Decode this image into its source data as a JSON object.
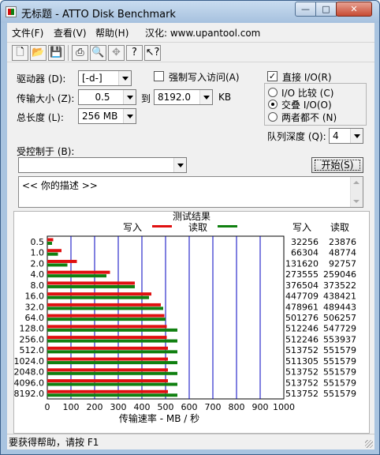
{
  "window": {
    "title": "无标题 - ATTO Disk Benchmark",
    "minimize": "—",
    "maximize": "□",
    "close": "✕"
  },
  "menu": [
    "文件(F)",
    "查看(V)",
    "帮助(H)",
    "汉化: www.upantool.com"
  ],
  "toolbar_icons": [
    "new-icon",
    "open-icon",
    "save-icon",
    "print-icon",
    "print-preview-icon",
    "move-icon",
    "help-icon",
    "context-help-icon"
  ],
  "form": {
    "drive_label": "驱动器 (D):",
    "drive_value": "[-d-]",
    "force_write_label": "强制写入访问(A)",
    "force_write_checked": false,
    "transfer_label": "传输大小 (Z):",
    "transfer_from": "0.5",
    "transfer_to_label": "到",
    "transfer_to": "8192.0",
    "transfer_unit": "KB",
    "total_length_label": "总长度 (L):",
    "total_length_value": "256 MB",
    "direct_io_label": "直接 I/O(R)",
    "direct_io_checked": true,
    "radio_compare": "I/O 比较 (C)",
    "radio_overlap": "交叠 I/O(O)",
    "radio_neither": "两者都不 (N)",
    "radio_selected": "overlap",
    "queue_depth_label": "队列深度 (Q):",
    "queue_depth_value": "4",
    "controlled_by_label": "受控制于 (B):",
    "controlled_by_value": "",
    "start_button": "开始(S)",
    "description": "<<  你的描述   >>"
  },
  "results": {
    "title": "测试结果",
    "legend_write": "写入",
    "legend_read": "读取",
    "col_write": "写入",
    "col_read": "读取",
    "xlabel": "传输速率 - MB / 秒"
  },
  "chart_data": {
    "type": "bar",
    "title": "测试结果",
    "xlabel": "传输速率 - MB / 秒",
    "xlim": [
      0,
      1000
    ],
    "xticks": [
      0,
      100,
      200,
      300,
      400,
      500,
      600,
      700,
      800,
      900,
      1000
    ],
    "categories": [
      "0.5",
      "1.0",
      "2.0",
      "4.0",
      "8.0",
      "16.0",
      "32.0",
      "64.0",
      "128.0",
      "256.0",
      "512.0",
      "1024.0",
      "2048.0",
      "4096.0",
      "8192.0"
    ],
    "series": [
      {
        "name": "写入",
        "color": "#e01010",
        "values": [
          25,
          60,
          125,
          265,
          370,
          440,
          480,
          495,
          505,
          505,
          510,
          510,
          510,
          510,
          510
        ]
      },
      {
        "name": "读取",
        "color": "#108010",
        "values": [
          20,
          45,
          85,
          250,
          370,
          430,
          490,
          500,
          550,
          550,
          550,
          550,
          550,
          550,
          550
        ]
      }
    ],
    "write_kb": [
      "32256",
      "66304",
      "131620",
      "273555",
      "376504",
      "447709",
      "478961",
      "501276",
      "512246",
      "512246",
      "513752",
      "511305",
      "513752",
      "513752",
      "513752"
    ],
    "read_kb": [
      "23876",
      "48774",
      "92757",
      "259046",
      "373522",
      "438421",
      "489443",
      "506257",
      "547729",
      "553937",
      "551579",
      "551579",
      "551579",
      "551579",
      "551579"
    ]
  },
  "status": "要获得帮助，请按 F1"
}
